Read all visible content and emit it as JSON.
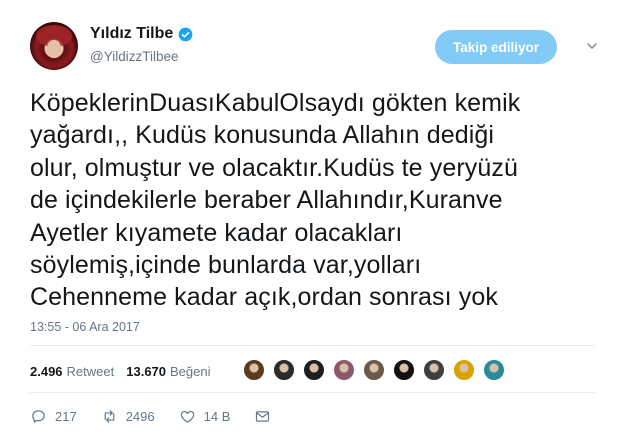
{
  "user": {
    "display_name": "Yıldız Tilbe",
    "handle": "@YildizzTilbee"
  },
  "follow_button_label": "Takip ediliyor",
  "tweet": {
    "text": "KöpeklerinDuasıKabulOlsaydı gökten kemik\nyağardı,, Kudüs konusunda Allahın dediği\nolur, olmuştur ve olacaktır.Kudüs te yeryüzü\nde içindekilerle beraber Allahındır,Kuranve\nAyetler kıyamete kadar olacakları\nsöylemiş,içinde bunlarda var,yolları\nCehenneme kadar açık,ordan sonrası yok",
    "timestamp": "13:55 - 06 Ara 2017"
  },
  "stats": {
    "retweets_count": "2.496",
    "retweets_label": "Retweet",
    "likes_count": "13.670",
    "likes_label": "Beğeni"
  },
  "likers": [
    {
      "icon": "avatar",
      "color": "#5b3a1e"
    },
    {
      "icon": "avatar",
      "color": "#2f2a2a"
    },
    {
      "icon": "avatar",
      "color": "#1e1e1e"
    },
    {
      "icon": "avatar",
      "color": "#8a5a6a"
    },
    {
      "icon": "avatar",
      "color": "#6b5a4a"
    },
    {
      "icon": "avatar",
      "color": "#111111"
    },
    {
      "icon": "avatar",
      "color": "#3e3e3e"
    },
    {
      "icon": "avatar",
      "color": "#d9a400"
    },
    {
      "icon": "avatar",
      "color": "#2a8a9a"
    }
  ],
  "actions": {
    "reply_count": "217",
    "retweet_count": "2496",
    "like_count": "14 B"
  },
  "colors": {
    "accent": "#1da1f2",
    "text": "#14171a",
    "muted": "#657786"
  }
}
